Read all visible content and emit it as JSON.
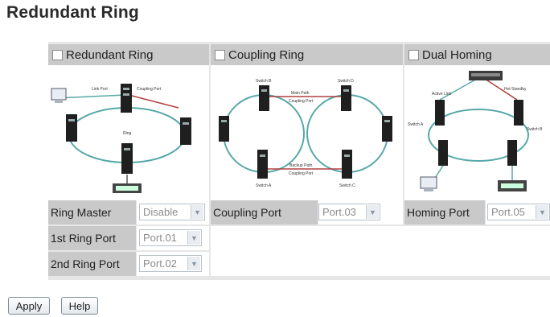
{
  "page_title": "Redundant Ring",
  "columns": {
    "redundant_ring": {
      "title": "Redundant Ring",
      "checked": false,
      "diagram_labels": {
        "left": "Link Port",
        "right": "Coupling Port",
        "center": "Ring"
      }
    },
    "coupling_ring": {
      "title": "Coupling Ring",
      "checked": false,
      "diagram_labels": {
        "switch_b": "Switch B",
        "switch_d": "Switch D",
        "main_path": "Main Path",
        "coupling_port_top": "Coupling Port",
        "backup_path": "Backup Path",
        "coupling_port_bottom": "Coupling Port",
        "switch_a": "Switch A",
        "switch_c": "Switch C"
      }
    },
    "dual_homing": {
      "title": "Dual Homing",
      "checked": false,
      "diagram_labels": {
        "active_link": "Active Link",
        "hot_standby": "Hot Standby",
        "switch_a": "Switch A",
        "switch_b": "Switch B"
      }
    }
  },
  "settings": {
    "ring_master": {
      "label": "Ring Master",
      "value": "Disable"
    },
    "first_ring_port": {
      "label": "1st Ring Port",
      "value": "Port.01"
    },
    "second_ring_port": {
      "label": "2nd Ring Port",
      "value": "Port.02"
    },
    "coupling_port": {
      "label": "Coupling Port",
      "value": "Port.03"
    },
    "homing_port": {
      "label": "Homing Port",
      "value": "Port.05"
    }
  },
  "buttons": {
    "apply": "Apply",
    "help": "Help"
  },
  "colors": {
    "ring": "#58a8a8",
    "header": "#c9c9c9",
    "panel": "#e6e6e6",
    "link_red": "#b04040"
  }
}
